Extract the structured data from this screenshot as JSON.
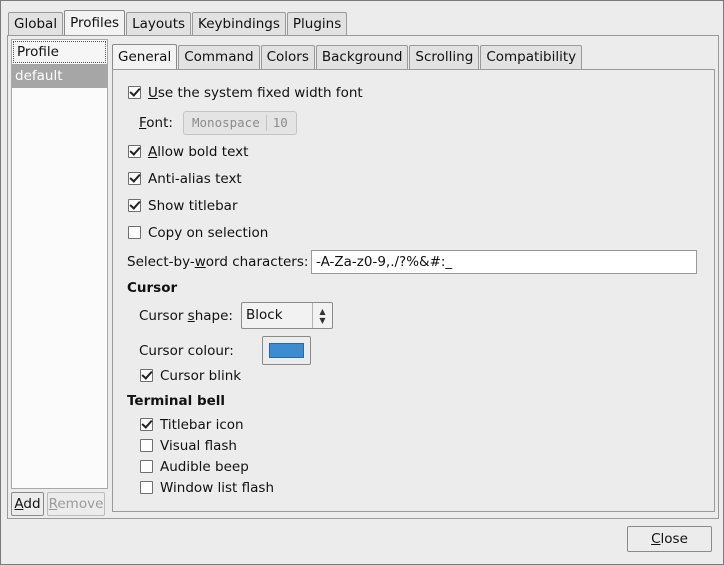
{
  "top_tabs": [
    "Global",
    "Profiles",
    "Layouts",
    "Keybindings",
    "Plugins"
  ],
  "active_top_tab": "Profiles",
  "profiles": {
    "header": "Profile",
    "items": [
      "default"
    ],
    "add_label": "Add",
    "add_mnemonic": "A",
    "add_rest": "dd",
    "remove_label": "Remove",
    "remove_mnemonic": "R",
    "remove_rest": "emove"
  },
  "inner_tabs": [
    "General",
    "Command",
    "Colors",
    "Background",
    "Scrolling",
    "Compatibility"
  ],
  "active_inner_tab": "General",
  "general": {
    "system_font": {
      "mn": "U",
      "rest": "se the system fixed width font",
      "checked": true
    },
    "font_label": {
      "mn": "F",
      "rest": "ont:"
    },
    "font_name": "Monospace",
    "font_size": "10",
    "allow_bold": {
      "mn": "A",
      "rest": "llow bold text",
      "checked": true
    },
    "anti_alias": {
      "label": "Anti-alias text",
      "checked": true
    },
    "show_titlebar": {
      "label": "Show titlebar",
      "checked": true
    },
    "copy_on_selection": {
      "label": "Copy on selection",
      "checked": false
    },
    "word_chars": {
      "pre": "Select-by-",
      "mn": "w",
      "post": "ord characters:",
      "value": "-A-Za-z0-9,./?%&#:_"
    },
    "cursor_heading": "Cursor",
    "cursor_shape": {
      "pre": "Cursor ",
      "mn": "s",
      "post": "hape:",
      "value": "Block"
    },
    "cursor_colour": {
      "label": "Cursor colour:",
      "color": "#3b8cd0"
    },
    "cursor_blink": {
      "label": "Cursor blink",
      "checked": true
    },
    "bell_heading": "Terminal bell",
    "titlebar_icon": {
      "label": "Titlebar icon",
      "checked": true
    },
    "visual_flash": {
      "label": "Visual flash",
      "checked": false
    },
    "audible_beep": {
      "label": "Audible beep",
      "checked": false
    },
    "window_list_flash": {
      "label": "Window list flash",
      "checked": false
    }
  },
  "close": {
    "mn": "C",
    "rest": "lose"
  }
}
